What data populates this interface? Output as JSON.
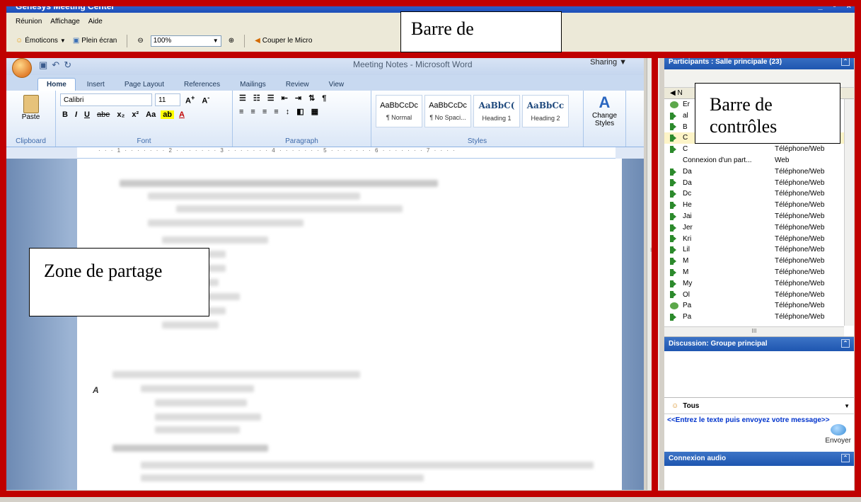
{
  "app": {
    "title": "Genesys Meeting Center",
    "window_controls": "_ ▫ ×"
  },
  "menu": {
    "items": [
      "Réunion",
      "Affichage",
      "Aide"
    ]
  },
  "toolbar": {
    "emoticons": "Émoticons",
    "fullscreen": "Plein écran",
    "zoom": "100%",
    "mute": "Couper le Micro"
  },
  "annotations": {
    "top": "Barre de",
    "controls_line1": "Barre de",
    "controls_line2": "contrôles",
    "share": "Zone de partage"
  },
  "word": {
    "doc_title": "Meeting Notes - Microsoft Word",
    "sharing": "Sharing ▼",
    "tabs": [
      "Home",
      "Insert",
      "Page Layout",
      "References",
      "Mailings",
      "Review",
      "View"
    ],
    "paste": "Paste",
    "font_name": "Calibri",
    "font_size": "11",
    "groups": {
      "clipboard": "Clipboard",
      "font": "Font",
      "paragraph": "Paragraph",
      "styles": "Styles"
    },
    "styles": [
      {
        "sample": "AaBbCcDc",
        "name": "¶ Normal"
      },
      {
        "sample": "AaBbCcDc",
        "name": "¶ No Spaci..."
      },
      {
        "sample": "AaBbC(",
        "name": "Heading 1"
      },
      {
        "sample": "AaBbCc",
        "name": "Heading 2"
      }
    ],
    "change_styles": "Change Styles",
    "ruler": "· · · 1 · · · · · · · 2 · · · · · · · 3 · · · · · · · 4 · · · · · · · 5 · · · · · · · 6 · · · · · · · 7 · · · ·",
    "page_letter": "A"
  },
  "participants": {
    "header": "Participants : Salle principale (23)",
    "col_name": "N",
    "rows": [
      {
        "name": "Er",
        "type": "",
        "icon": "phone"
      },
      {
        "name": "al",
        "type": "",
        "icon": "spk"
      },
      {
        "name": "B",
        "type": "",
        "icon": "spk"
      },
      {
        "name": "C",
        "type": "",
        "icon": "spk",
        "selected": true
      },
      {
        "name": "C",
        "type": "Téléphone/Web",
        "icon": "spk"
      },
      {
        "name": "Connexion d'un part...",
        "type": "Web",
        "icon": "none"
      },
      {
        "name": "Da",
        "type": "Téléphone/Web",
        "icon": "spk"
      },
      {
        "name": "Da",
        "type": "Téléphone/Web",
        "icon": "spk"
      },
      {
        "name": "Dc",
        "type": "Téléphone/Web",
        "icon": "spk"
      },
      {
        "name": "He",
        "type": "Téléphone/Web",
        "icon": "spk"
      },
      {
        "name": "Jai",
        "type": "Téléphone/Web",
        "icon": "spk"
      },
      {
        "name": "Jer",
        "type": "Téléphone/Web",
        "icon": "spk"
      },
      {
        "name": "Kri",
        "type": "Téléphone/Web",
        "icon": "spk"
      },
      {
        "name": "Lil",
        "type": "Téléphone/Web",
        "icon": "spk"
      },
      {
        "name": "M",
        "type": "Téléphone/Web",
        "icon": "spk"
      },
      {
        "name": "M",
        "type": "Téléphone/Web",
        "icon": "spk"
      },
      {
        "name": "My",
        "type": "Téléphone/Web",
        "icon": "spk"
      },
      {
        "name": "Ol",
        "type": "Téléphone/Web",
        "icon": "spk"
      },
      {
        "name": "Pa",
        "type": "Téléphone/Web",
        "icon": "phone"
      },
      {
        "name": "Pa",
        "type": "Téléphone/Web",
        "icon": "spk"
      }
    ],
    "hscroll": "III"
  },
  "chat": {
    "header": "Discussion: Groupe principal",
    "recipient": "Tous",
    "placeholder": "<<Entrez le texte puis envoyez votre message>>",
    "send": "Envoyer"
  },
  "audio": {
    "header": "Connexion audio"
  },
  "colors": {
    "frame": "#c00000",
    "panel_header": "#1e56b0"
  }
}
